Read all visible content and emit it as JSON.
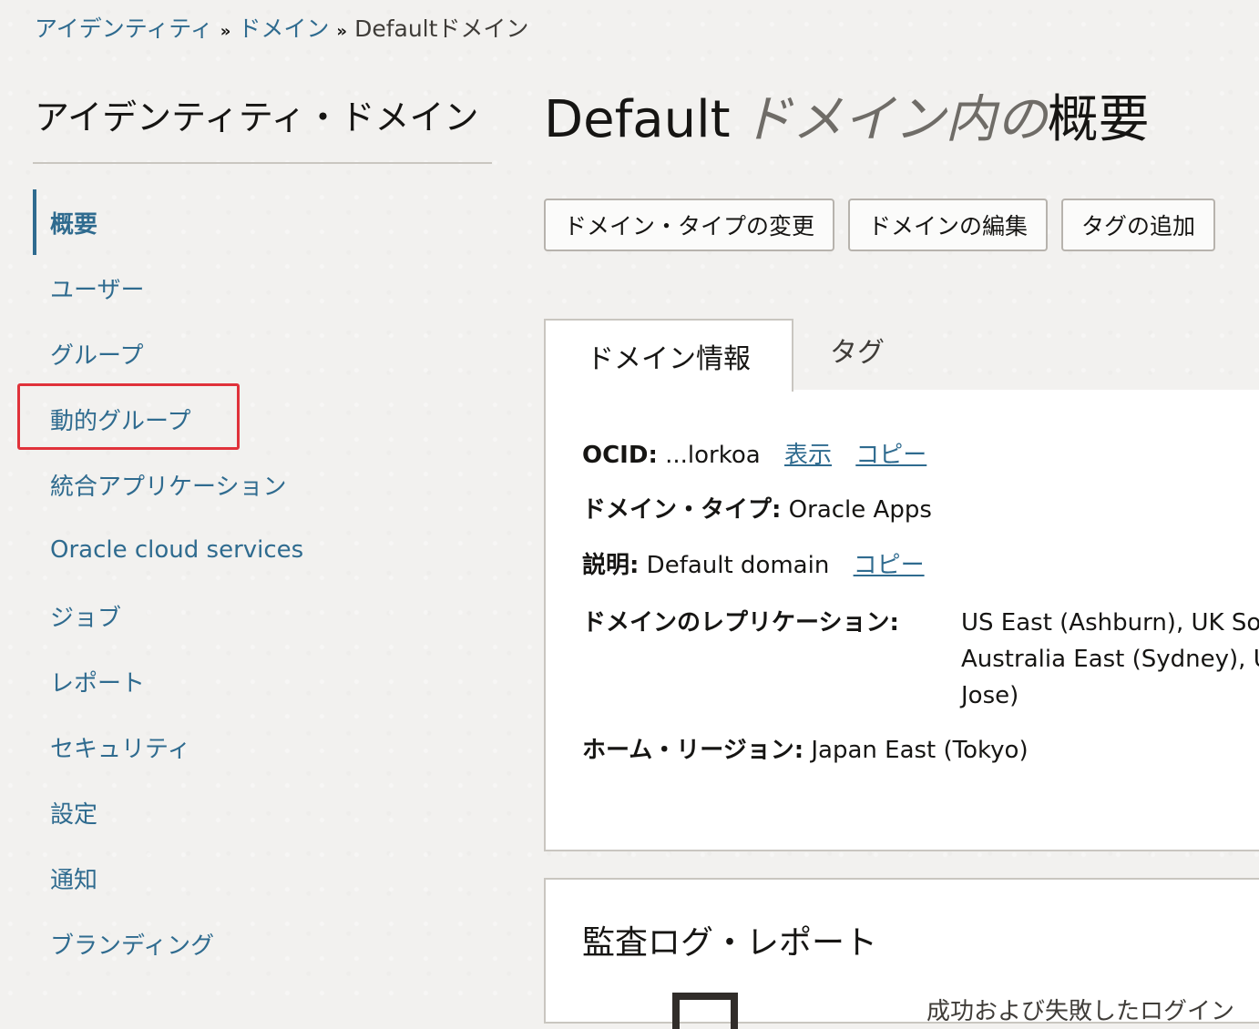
{
  "breadcrumb": {
    "items": [
      "アイデンティティ",
      "ドメイン"
    ],
    "separator": "»",
    "current": "Defaultドメイン"
  },
  "nav": {
    "title": "アイデンティティ・ドメイン",
    "items": [
      {
        "label": "概要",
        "active": true
      },
      {
        "label": "ユーザー"
      },
      {
        "label": "グループ"
      },
      {
        "label": "動的グループ",
        "highlighted": true
      },
      {
        "label": "統合アプリケーション"
      },
      {
        "label": "Oracle cloud services"
      },
      {
        "label": "ジョブ"
      },
      {
        "label": "レポート"
      },
      {
        "label": "セキュリティ"
      },
      {
        "label": "設定"
      },
      {
        "label": "通知"
      },
      {
        "label": "ブランディング"
      }
    ]
  },
  "header": {
    "domain_name": "Default",
    "subtitle": "ドメイン内の",
    "overview": "概要"
  },
  "actions": {
    "change_type": "ドメイン・タイプの変更",
    "edit_domain": "ドメインの編集",
    "add_tags": "タグの追加"
  },
  "tabs": {
    "domain_info": "ドメイン情報",
    "tags": "タグ"
  },
  "info": {
    "ocid_label": "OCID:",
    "ocid_value": "...lorkoa",
    "show_link": "表示",
    "copy_link": "コピー",
    "type_label": "ドメイン・タイプ:",
    "type_value": "Oracle Apps",
    "desc_label": "説明:",
    "desc_value": "Default domain",
    "desc_copy": "コピー",
    "replication_label": "ドメインのレプリケーション:",
    "replication_line1": "US East (Ashburn), UK South",
    "replication_line2": "Australia East (Sydney), US M",
    "replication_line3": "Jose)",
    "home_label": "ホーム・リージョン:",
    "home_value": "Japan East (Tokyo)"
  },
  "audit": {
    "title": "監査ログ・レポート",
    "text": "成功および失敗したログイン"
  },
  "colors": {
    "link": "#2f6b8f",
    "highlight": "#e0323a",
    "background": "#f2f1ef"
  }
}
